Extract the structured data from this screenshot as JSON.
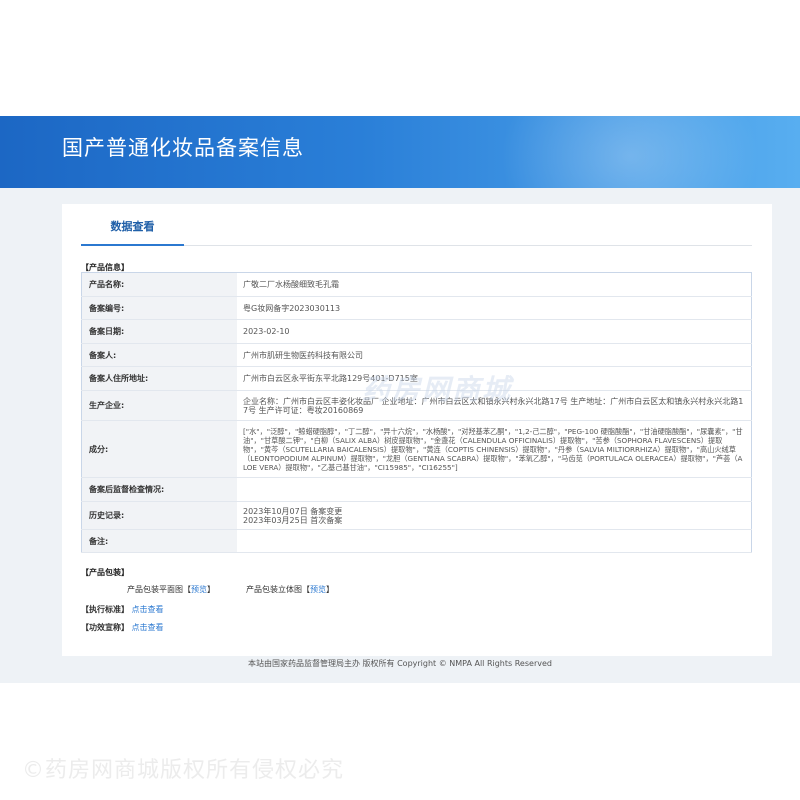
{
  "header": {
    "title": "国产普通化妆品备案信息"
  },
  "tabs": [
    {
      "label": "数据查看"
    }
  ],
  "product_info": {
    "section_title": "【产品信息】",
    "rows": [
      {
        "label": "产品名称:",
        "value": "广敬二厂水杨酸细致毛孔霜"
      },
      {
        "label": "备案编号:",
        "value": "粤G妆网备字2023030113"
      },
      {
        "label": "备案日期:",
        "value": "2023-02-10"
      },
      {
        "label": "备案人:",
        "value": "广州市肌研生物医药科技有限公司"
      },
      {
        "label": "备案人住所地址:",
        "value": "广州市白云区永平街东平北路129号401-D715室"
      },
      {
        "label": "生产企业:",
        "value": "企业名称：广州市白云区丰姿化妆品厂 企业地址：广州市白云区太和镇永兴村永兴北路17号 生产地址：广州市白云区太和镇永兴村永兴北路17号 生产许可证：粤妆20160869"
      },
      {
        "label": "成分:",
        "value": "[\"水\"，\"泛醇\"，\"鲸蜡硬脂醇\"，\"丁二醇\"，\"异十六烷\"，\"水杨酸\"，\"对羟基苯乙酮\"，\"1,2-己二醇\"，\"PEG-100 硬脂酸酯\"，\"甘油硬脂酸酯\"，\"尿囊素\"，\"甘油\"，\"甘草酸二钾\"，\"白柳（SALIX ALBA）树皮提取物\"，\"金盏花（CALENDULA OFFICINALIS）提取物\"，\"苦参（SOPHORA FLAVESCENS）提取物\"，\"黄芩（SCUTELLARIA BAICALENSIS）提取物\"，\"黄连（COPTIS CHINENSIS）提取物\"，\"丹参（SALVIA MILTIORRHIZA）提取物\"，\"高山火绒草（LEONTOPODIUM ALPINUM）提取物\"，\"龙胆（GENTIANA SCABRA）提取物\"，\"苯氧乙醇\"，\"马齿苋（PORTULACA OLERACEA）提取物\"，\"芦荟（ALOE VERA）提取物\"，\"乙基己基甘油\"，\"CI15985\"，\"CI16255\"]"
      },
      {
        "label": "备案后监督检查情况:",
        "value": ""
      },
      {
        "label": "历史记录:",
        "lines": [
          "2023年10月07日 备案变更",
          "2023年03月25日 首次备案"
        ]
      },
      {
        "label": "备注:",
        "value": ""
      }
    ]
  },
  "packaging": {
    "section_title": "【产品包装】",
    "items": [
      {
        "label": "产品包装平面图",
        "bracket_open": "【",
        "link": "预览",
        "bracket_close": "】"
      },
      {
        "label": "产品包装立体图",
        "bracket_open": "【",
        "link": "预览",
        "bracket_close": "】"
      }
    ]
  },
  "standard": {
    "label": "【执行标准】",
    "link": "点击查看"
  },
  "efficacy": {
    "label": "【功效宣称】",
    "link": "点击查看"
  },
  "footer": {
    "text": "本站由国家药品监督管理局主办 版权所有 Copyright © NMPA All Rights Reserved"
  },
  "watermarks": {
    "center": "药房网商城",
    "bottom": "©药房网商城版权所有侵权必究"
  },
  "colors": {
    "banner": "#1c67c4",
    "accent": "#2b78d0",
    "page_bg": "#eef2f6"
  }
}
